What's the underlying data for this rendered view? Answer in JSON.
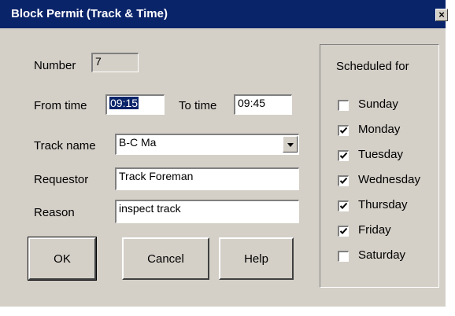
{
  "window": {
    "title": "Block Permit (Track & Time)",
    "close_glyph": "×"
  },
  "form": {
    "number_label": "Number",
    "number_value": "7",
    "from_time_label": "From time",
    "from_time_value": "09:15",
    "to_time_label": "To time",
    "to_time_value": "09:45",
    "track_name_label": "Track name",
    "track_name_value": "B-C Ma",
    "requestor_label": "Requestor",
    "requestor_value": "Track Foreman",
    "reason_label": "Reason",
    "reason_value": "inspect track"
  },
  "buttons": {
    "ok": "OK",
    "cancel": "Cancel",
    "help": "Help"
  },
  "schedule": {
    "title": "Scheduled for",
    "days": [
      {
        "label": "Sunday",
        "checked": false
      },
      {
        "label": "Monday",
        "checked": true
      },
      {
        "label": "Tuesday",
        "checked": true
      },
      {
        "label": "Wednesday",
        "checked": true
      },
      {
        "label": "Thursday",
        "checked": true
      },
      {
        "label": "Friday",
        "checked": true
      },
      {
        "label": "Saturday",
        "checked": false
      }
    ]
  }
}
